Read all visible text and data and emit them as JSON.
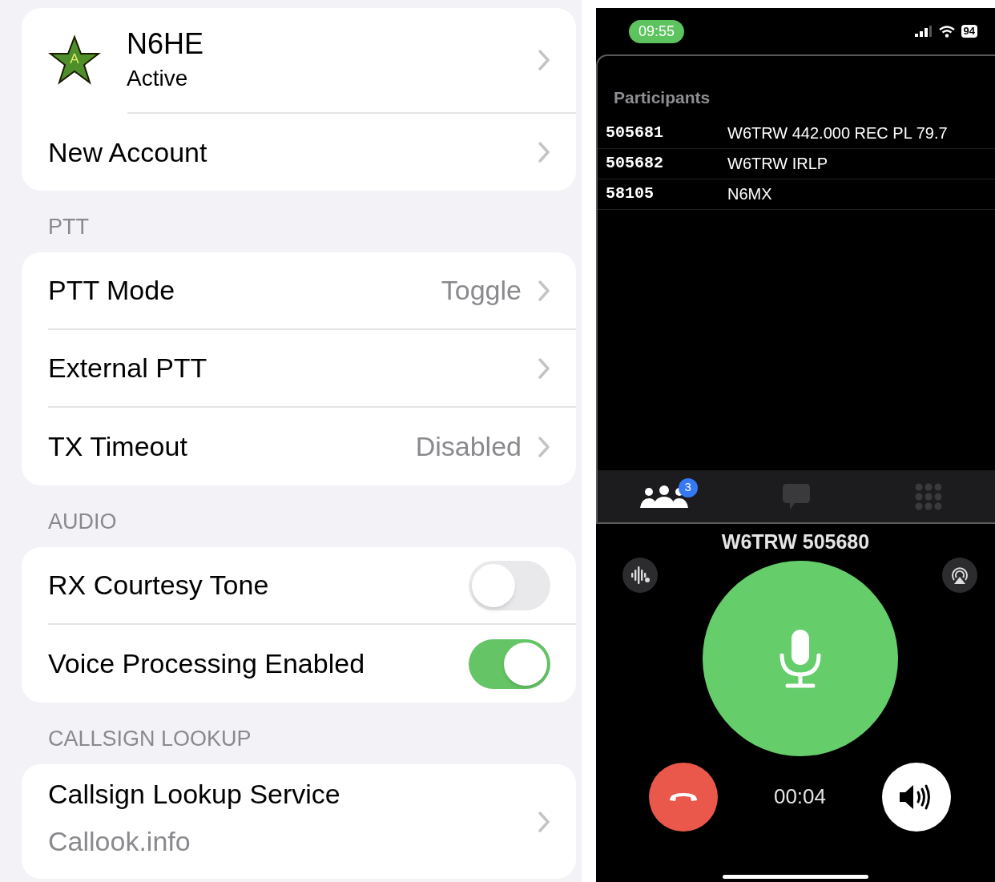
{
  "account": {
    "badge": "A",
    "name": "N6HE",
    "status": "Active",
    "new_account": "New Account"
  },
  "sections": [
    {
      "header": "PTT",
      "rows": [
        {
          "kind": "value",
          "label": "PTT Mode",
          "value": "Toggle"
        },
        {
          "kind": "link",
          "label": "External PTT"
        },
        {
          "kind": "value",
          "label": "TX Timeout",
          "value": "Disabled"
        }
      ]
    },
    {
      "header": "AUDIO",
      "rows": [
        {
          "kind": "toggle",
          "label": "RX Courtesy Tone",
          "on": false
        },
        {
          "kind": "toggle",
          "label": "Voice Processing Enabled",
          "on": true
        }
      ]
    },
    {
      "header": "CALLSIGN LOOKUP",
      "rows": [
        {
          "kind": "subtitle",
          "label": "Callsign Lookup Service",
          "value": "Callook.info"
        }
      ]
    }
  ],
  "call": {
    "status_bar": {
      "time": "09:55",
      "battery": "94"
    },
    "participants": {
      "title": "Participants",
      "rows": [
        {
          "node": "505681",
          "name": "W6TRW 442.000 REC PL 79.7"
        },
        {
          "node": "505682",
          "name": "W6TRW IRLP"
        },
        {
          "node": "58105",
          "name": "N6MX"
        }
      ]
    },
    "tabs": [
      {
        "kind": "people",
        "badge": "3",
        "selected": true
      },
      {
        "kind": "chat",
        "selected": false
      },
      {
        "kind": "keypad",
        "selected": false
      }
    ],
    "title": "W6TRW 505680",
    "timer": "00:04"
  }
}
